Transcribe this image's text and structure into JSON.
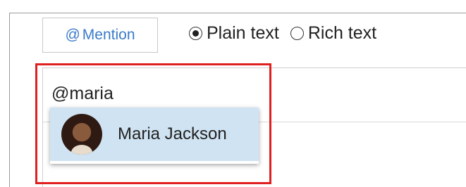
{
  "toolbar": {
    "mention_at": "@",
    "mention_label": "Mention",
    "formats": [
      {
        "label": "Plain text",
        "selected": true
      },
      {
        "label": "Rich text",
        "selected": false
      }
    ]
  },
  "editor": {
    "text": "@maria"
  },
  "suggestions": [
    {
      "name": "Maria Jackson",
      "icon": "avatar"
    }
  ],
  "colors": {
    "accent": "#3a7bc8",
    "highlight_border": "#e02020",
    "suggestion_selected_bg": "#cfe3f2"
  }
}
